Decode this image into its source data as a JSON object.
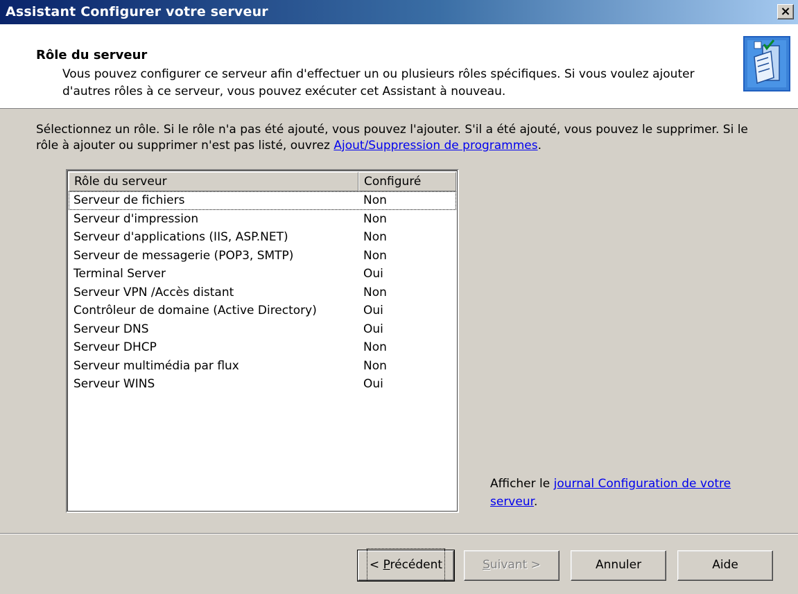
{
  "window": {
    "title": "Assistant Configurer votre serveur",
    "close_glyph": "×"
  },
  "header": {
    "title": "Rôle du serveur",
    "description": "Vous pouvez configurer ce serveur afin d'effectuer un ou plusieurs rôles spécifiques. Si vous voulez ajouter d'autres rôles à ce serveur, vous pouvez exécuter cet Assistant à nouveau.",
    "icon": "wizard-checklist-icon"
  },
  "intro": {
    "text": "Sélectionnez un rôle. Si le rôle n'a pas été ajouté, vous pouvez l'ajouter. S'il a été ajouté, vous pouvez le supprimer. Si le rôle à ajouter ou supprimer n'est pas listé, ouvrez ",
    "link": "Ajout/Suppression de programmes",
    "suffix": "."
  },
  "roles": {
    "columns": [
      "Rôle du serveur",
      "Configuré"
    ],
    "rows": [
      {
        "role": "Serveur de fichiers",
        "configured": "Non"
      },
      {
        "role": "Serveur d'impression",
        "configured": "Non"
      },
      {
        "role": "Serveur d'applications (IIS, ASP.NET)",
        "configured": "Non"
      },
      {
        "role": "Serveur de messagerie (POP3, SMTP)",
        "configured": "Non"
      },
      {
        "role": "Terminal Server",
        "configured": "Oui"
      },
      {
        "role": "Serveur VPN /Accès distant",
        "configured": "Non"
      },
      {
        "role": "Contrôleur de domaine (Active Directory)",
        "configured": "Oui"
      },
      {
        "role": "Serveur DNS",
        "configured": "Oui"
      },
      {
        "role": "Serveur DHCP",
        "configured": "Non"
      },
      {
        "role": "Serveur multimédia par flux",
        "configured": "Non"
      },
      {
        "role": "Serveur WINS",
        "configured": "Oui"
      }
    ]
  },
  "log": {
    "prefix": "Afficher le ",
    "link": "journal Configuration de votre serveur",
    "suffix": "."
  },
  "buttons": {
    "prev_pre": "< ",
    "prev_mn": "P",
    "prev_post": "récédent",
    "next_mn": "S",
    "next_post": "uivant >",
    "cancel": "Annuler",
    "help": "Aide"
  }
}
